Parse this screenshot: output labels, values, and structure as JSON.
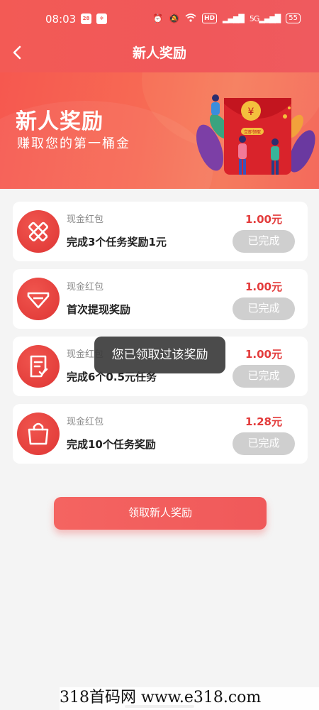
{
  "status_bar": {
    "time": "08:03",
    "icon_labels": [
      "28",
      "HD",
      "55"
    ],
    "signal_text": "5G"
  },
  "nav": {
    "title": "新人奖励"
  },
  "banner": {
    "title": "新人奖励",
    "subtitle": "赚取您的第一桶金",
    "art_caption": "立即领取"
  },
  "tasks": [
    {
      "type": "现金红包",
      "desc": "完成3个任务奖励1元",
      "amount": "1.00元",
      "status": "已完成",
      "icon": "pencil-ruler-icon"
    },
    {
      "type": "现金红包",
      "desc": "首次提现奖励",
      "amount": "1.00元",
      "status": "已完成",
      "icon": "diamond-icon"
    },
    {
      "type": "现金红包",
      "desc": "完成6个0.5元任务",
      "amount": "1.00元",
      "status": "已完成",
      "icon": "checklist-icon"
    },
    {
      "type": "现金红包",
      "desc": "完成10个任务奖励",
      "amount": "1.28元",
      "status": "已完成",
      "icon": "shopping-bag-icon"
    }
  ],
  "toast": "您已领取过该奖励",
  "claim_button": "领取新人奖励",
  "watermark": "318首码网  www.e318.com",
  "colors": {
    "brand_red": "#f35a55",
    "amount_red": "#e33b3b",
    "disabled_gray": "#cfcfcf"
  }
}
